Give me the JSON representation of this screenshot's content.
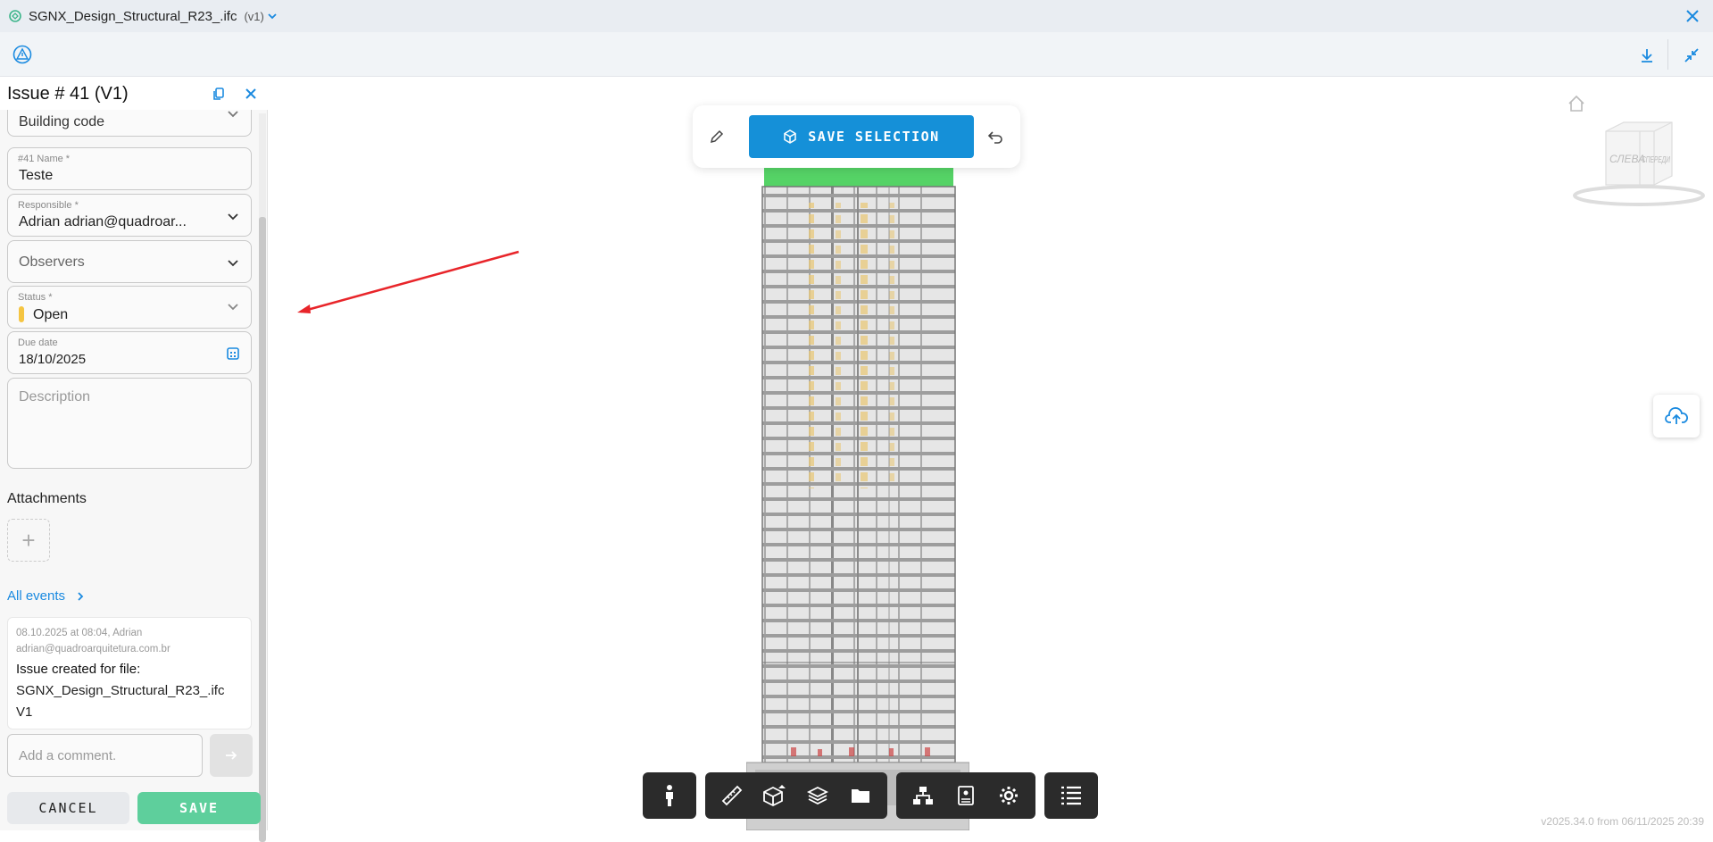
{
  "titlebar": {
    "file_name": "SGNX_Design_Structural_R23_.ifc",
    "version": "(v1)"
  },
  "panel": {
    "title": "Issue # 41 (V1)",
    "building_code": "Building code",
    "name_label": "#41 Name *",
    "name_value": "Teste",
    "responsible_label": "Responsible *",
    "responsible_value": "Adrian adrian@quadroar...",
    "observers_placeholder": "Observers",
    "status_label": "Status *",
    "status_value": "Open",
    "status_color": "#f5c542",
    "due_label": "Due date",
    "due_value": "18/10/2025",
    "description_placeholder": "Description",
    "attachments_label": "Attachments",
    "all_events_label": "All events",
    "event": {
      "meta_line1": "08.10.2025 at 08:04, Adrian",
      "meta_line2": "adrian@quadroarquitetura.com.br",
      "title": "Issue created for file:",
      "file_line1": "SGNX_Design_Structural_R23_.ifc",
      "file_line2": "V1"
    },
    "comment_placeholder": "Add a comment.",
    "cancel_label": "CANCEL",
    "save_label": "SAVE"
  },
  "viewport": {
    "save_selection_label": "SAVE SELECTION",
    "cube_left_label": "СЛЕВА",
    "cube_right_label": "СПЕРЕДИ",
    "version_text": "v2025.34.0 from 06/11/2025 20:39"
  },
  "colors": {
    "accent": "#1590d8",
    "save_green": "#5ecf9c",
    "arrow_red": "#e8252a"
  },
  "icons": {
    "bottom_bar": [
      "person-icon",
      "ruler-icon",
      "section-box-icon",
      "layers-icon",
      "folder-icon",
      "tree-icon",
      "properties-icon",
      "settings-icon",
      "list-icon"
    ]
  }
}
